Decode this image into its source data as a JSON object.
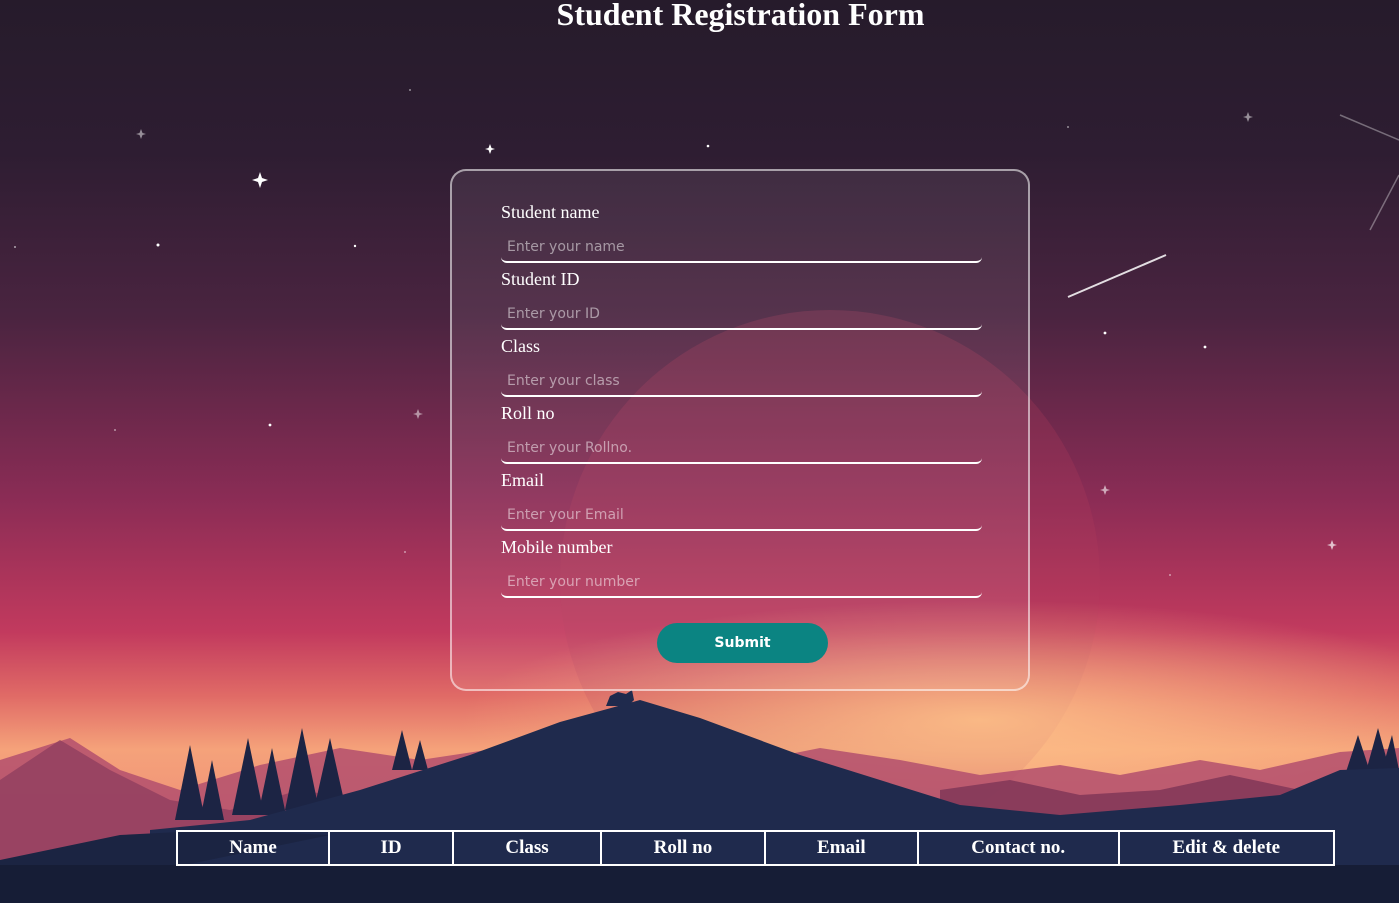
{
  "page": {
    "title": "Student Registration Form"
  },
  "form": {
    "fields": [
      {
        "label": "Student name",
        "placeholder": "Enter your name"
      },
      {
        "label": "Student ID",
        "placeholder": "Enter your ID"
      },
      {
        "label": "Class",
        "placeholder": "Enter your class"
      },
      {
        "label": "Roll no",
        "placeholder": "Enter your Rollno."
      },
      {
        "label": "Email",
        "placeholder": "Enter your Email"
      },
      {
        "label": "Mobile number",
        "placeholder": "Enter your number"
      }
    ],
    "submit_label": "Submit"
  },
  "table": {
    "headers": [
      "Name",
      "ID",
      "Class",
      "Roll no",
      "Email",
      "Contact no.",
      "Edit & delete"
    ]
  },
  "colors": {
    "submit_button": "#0b8482",
    "sky_top": "#261b2b",
    "sky_horizon": "#f5a27a",
    "mountain": "#1f2a4d"
  }
}
